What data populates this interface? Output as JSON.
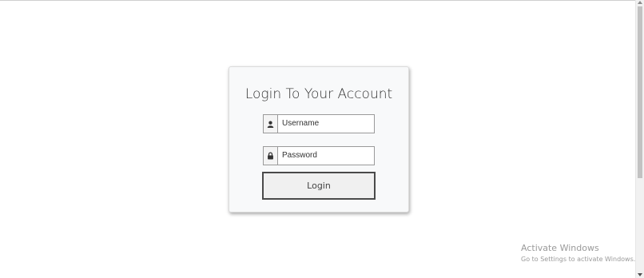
{
  "login": {
    "title": "Login To Your Account",
    "username_placeholder": "Username",
    "password_placeholder": "Password",
    "button_label": "Login",
    "icons": {
      "username": "user-icon",
      "password": "lock-icon"
    }
  },
  "watermark": {
    "title": "Activate Windows",
    "subtitle": "Go to Settings to activate Windows."
  }
}
